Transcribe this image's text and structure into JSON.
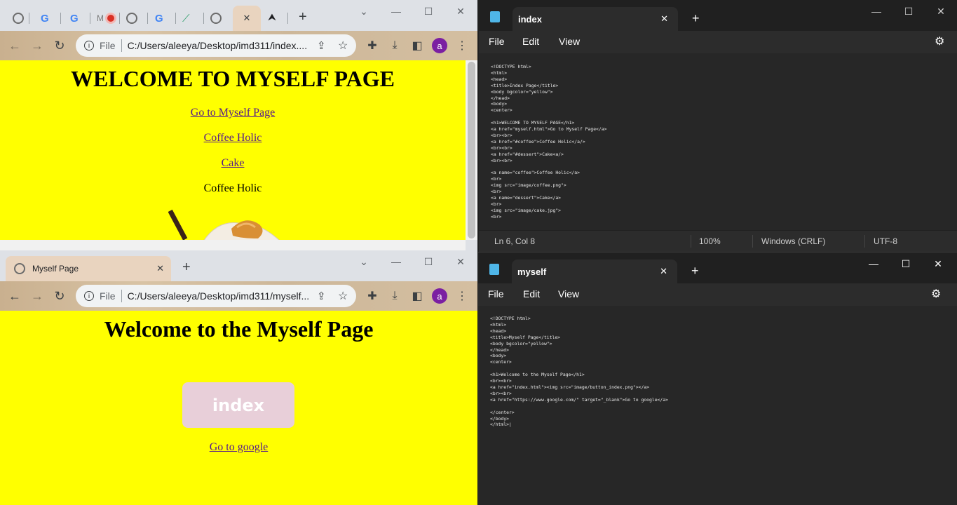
{
  "browser1": {
    "tabs": [
      {
        "icon": "globe-icon",
        "color": "#6b6b6b"
      },
      {
        "icon": "google-icon",
        "color": "#4285f4"
      },
      {
        "icon": "google-icon",
        "color": "#4285f4"
      },
      {
        "icon": "m-icon",
        "label": "M",
        "color": "#7a7a7a"
      },
      {
        "icon": "record-icon",
        "color": "#d93025"
      },
      {
        "icon": "globe-icon",
        "color": "#6b6b6b"
      },
      {
        "icon": "google-icon",
        "color": "#4285f4"
      },
      {
        "icon": "leaf-icon",
        "color": "#2e9e6b"
      },
      {
        "icon": "globe-icon",
        "color": "#6b6b6b"
      }
    ],
    "active_tab_close": "✕",
    "new_tab": "+",
    "address_scheme": "File",
    "address_url": "C:/Users/aleeya/Desktop/imd311/index....",
    "avatar_letter": "a",
    "page": {
      "heading": "WELCOME TO MYSELF PAGE",
      "links": [
        "Go to Myself Page",
        "Coffee Holic",
        "Cake"
      ],
      "anchor_text": "Coffee Holic"
    }
  },
  "browser2": {
    "tab_title": "Myself Page",
    "new_tab": "+",
    "address_scheme": "File",
    "address_url": "C:/Users/aleeya/Desktop/imd311/myself...",
    "avatar_letter": "a",
    "page": {
      "heading": "Welcome to the Myself Page",
      "button_label": "index",
      "link": "Go to google"
    }
  },
  "notepad1": {
    "tab_title": "index",
    "menu": [
      "File",
      "Edit",
      "View"
    ],
    "code": "<!DOCTYPE html>\n<html>\n<head>\n<title>Index Page</title>\n<body bgcolor=\"yellow\">\n</head>\n<body>\n<center>\n\n<h1>WELCOME TO MYSELF PAGE</h1>\n<a href=\"myself.html\">Go to Myself Page</a>\n<br><br>\n<a href=\"#coffee\">Coffee Holic</a/>\n<br><br>\n<a href=\"#dessert\">Cake<a/>\n<br><br>\n\n<a name=\"coffee\">Coffee Holic</a>\n<br>\n<img src=\"image/coffee.png\">\n<br>\n<a name=\"dessert\">Cake</a>\n<br>\n<img src=\"image/cake.jpg\">\n<br>",
    "status": {
      "position": "Ln 6, Col 8",
      "zoom": "100%",
      "line_ending": "Windows (CRLF)",
      "encoding": "UTF-8"
    }
  },
  "notepad2": {
    "tab_title": "myself",
    "menu": [
      "File",
      "Edit",
      "View"
    ],
    "code": "<!DOCTYPE html>\n<html>\n<head>\n<title>Myself Page</title>\n<body bgcolor=\"yellow\">\n</head>\n<body>\n<center>\n\n<h1>Welcome to the Myself Page</h1>\n<br><br>\n<a href=\"index.html\"><img src=\"image/button_index.png\"></a>\n<br><br>\n<a href=\"https://www.google.com/\" target=\"_blank\">Go to google</a>\n\n</center>\n</body>\n</html>|"
  },
  "colors": {
    "page_bg": "#ffff00",
    "link": "#551a8b",
    "button_bg": "#e8cfd9",
    "avatar": "#7b1fa2"
  }
}
